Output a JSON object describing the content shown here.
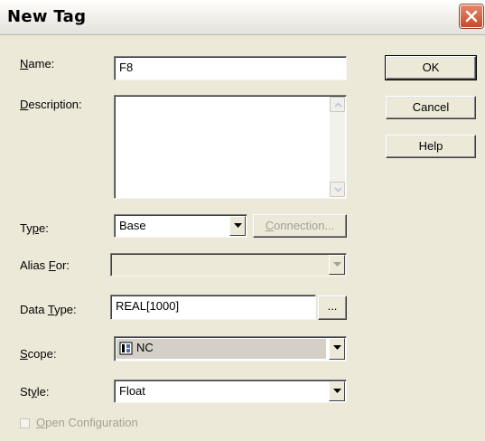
{
  "window": {
    "title": "New Tag"
  },
  "fields": {
    "name": {
      "label_prefix": "",
      "label_hotkey": "N",
      "label_suffix": "ame:",
      "value": "F8"
    },
    "description": {
      "label_prefix": "",
      "label_hotkey": "D",
      "label_suffix": "escription:",
      "value": ""
    },
    "type": {
      "label_prefix": "Ty",
      "label_hotkey": "p",
      "label_suffix": "e:",
      "value": "Base"
    },
    "alias_for": {
      "label_prefix": "Alias ",
      "label_hotkey": "F",
      "label_suffix": "or:",
      "value": ""
    },
    "data_type": {
      "label_prefix": "Data ",
      "label_hotkey": "T",
      "label_suffix": "ype:",
      "value": "REAL[1000]"
    },
    "scope": {
      "label_prefix": "",
      "label_hotkey": "S",
      "label_suffix": "cope:",
      "value": "NC"
    },
    "style": {
      "label_prefix": "St",
      "label_hotkey": "y",
      "label_suffix": "le:",
      "value": "Float"
    }
  },
  "buttons": {
    "ok": "OK",
    "cancel": "Cancel",
    "help": "Help",
    "connection_prefix": "",
    "connection_hotkey": "C",
    "connection_suffix": "onnection...",
    "browse": "..."
  },
  "open_configuration": {
    "prefix": "",
    "hotkey": "O",
    "suffix": "pen Configuration",
    "checked": false
  },
  "colors": {
    "selection_bg": "#d4d0c8",
    "close_red": "#d9593a"
  }
}
